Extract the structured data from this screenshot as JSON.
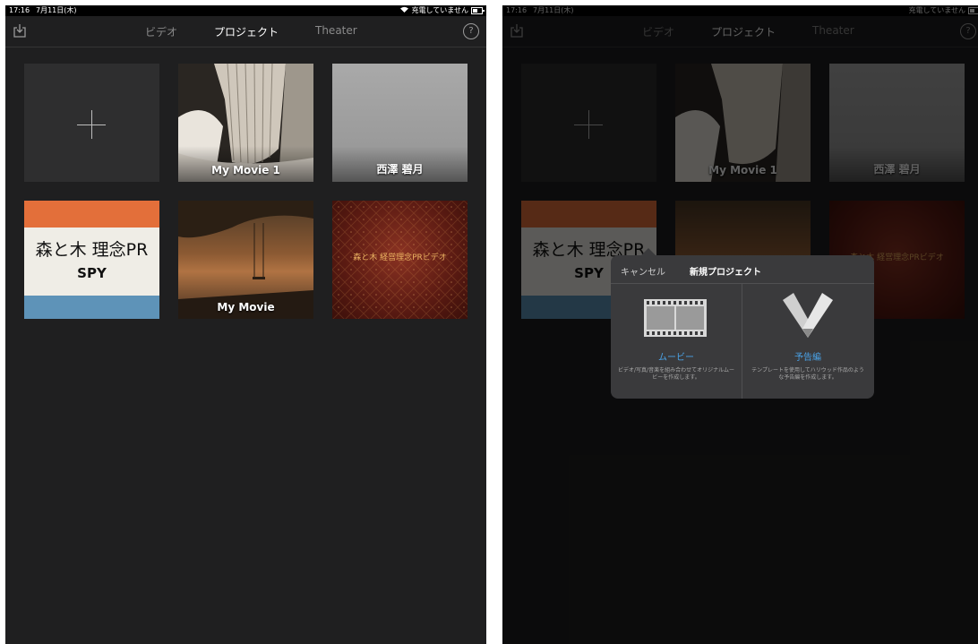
{
  "status": {
    "time": "17:16",
    "date": "7月11日(木)",
    "charging": "充電していません"
  },
  "nav": {
    "tabs": [
      "ビデオ",
      "プロジェクト",
      "Theater"
    ],
    "active_tab": "プロジェクト"
  },
  "projects": [
    {
      "title": "My Movie 1"
    },
    {
      "title": "西澤 碧月"
    },
    {
      "title": "森と木 理念PR",
      "subtitle": "SPY"
    },
    {
      "title": "My Movie"
    },
    {
      "title": "森と木 経営理念PRビデオ"
    }
  ],
  "popover": {
    "cancel": "キャンセル",
    "title": "新規プロジェクト",
    "movie": {
      "label": "ムービー",
      "desc": "ビデオ/写真/音楽を組み合わせてオリジナルムービーを作成します。"
    },
    "trailer": {
      "label": "予告編",
      "desc": "テンプレートを使用してハリウッド作品のような予告編を作成します。"
    }
  },
  "colors": {
    "accent": "#4aa3e8",
    "background": "#1f1f20"
  }
}
